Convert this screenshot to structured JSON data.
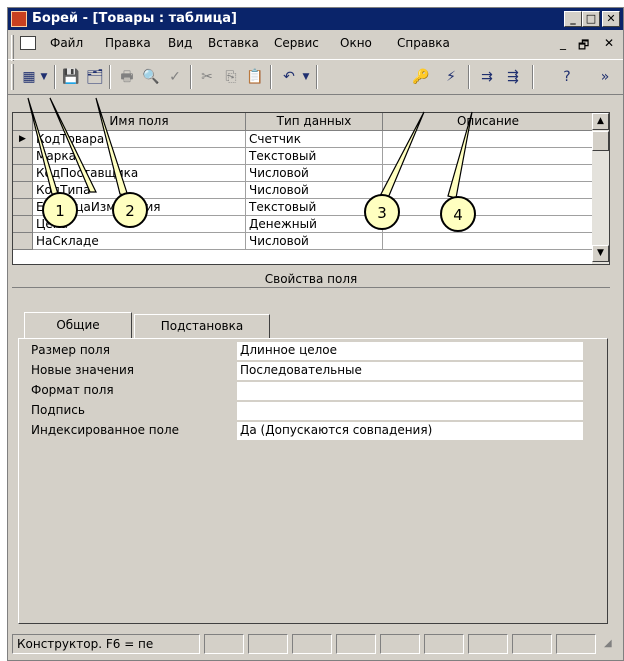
{
  "window": {
    "title": "Борей - [Товары : таблица]",
    "controls": {
      "minimize": "_",
      "maximize": "□",
      "close": "✕"
    }
  },
  "menu": {
    "items": [
      "Файл",
      "Правка",
      "Вид",
      "Вставка",
      "Сервис",
      "Окно",
      "Справка"
    ],
    "doc_min": "_",
    "doc_restore": "🗗",
    "doc_close": "✕"
  },
  "grid": {
    "headers": {
      "name": "Имя поля",
      "type": "Тип данных",
      "desc": "Описание"
    },
    "rows": [
      {
        "name": "КодТовара",
        "type": "Счетчик"
      },
      {
        "name": "Марка",
        "type": "Текстовый"
      },
      {
        "name": "КодПоставщика",
        "type": "Числовой"
      },
      {
        "name": "КодТипа",
        "type": "Числовой"
      },
      {
        "name": "ЕдиницаИзмерения",
        "type": "Текстовый"
      },
      {
        "name": "Цена",
        "type": "Денежный"
      },
      {
        "name": "НаСкладе",
        "type": "Числовой"
      }
    ],
    "current_row_marker": "▶"
  },
  "properties": {
    "title": "Свойства поля",
    "tabs": [
      "Общие",
      "Подстановка"
    ],
    "fields": [
      {
        "label": "Размер поля",
        "value": "Длинное целое"
      },
      {
        "label": "Новые значения",
        "value": "Последовательные"
      },
      {
        "label": "Формат поля",
        "value": ""
      },
      {
        "label": "Подпись",
        "value": ""
      },
      {
        "label": "Индексированное поле",
        "value": "Да (Допускаются совпадения)"
      }
    ]
  },
  "status": {
    "text": "Конструктор.  F6 = пе"
  },
  "callouts": [
    "1",
    "2",
    "3",
    "4"
  ]
}
